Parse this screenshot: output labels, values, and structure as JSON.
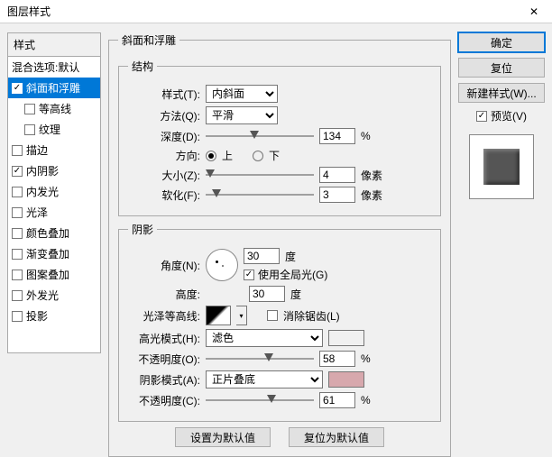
{
  "window": {
    "title": "图层样式"
  },
  "sidebar": {
    "header": "样式",
    "items": [
      {
        "label": "混合选项:默认",
        "checkbox": false,
        "checked": false,
        "selected": false,
        "indent": false
      },
      {
        "label": "斜面和浮雕",
        "checkbox": true,
        "checked": true,
        "selected": true,
        "indent": false
      },
      {
        "label": "等高线",
        "checkbox": true,
        "checked": false,
        "selected": false,
        "indent": true
      },
      {
        "label": "纹理",
        "checkbox": true,
        "checked": false,
        "selected": false,
        "indent": true
      },
      {
        "label": "描边",
        "checkbox": true,
        "checked": false,
        "selected": false,
        "indent": false
      },
      {
        "label": "内阴影",
        "checkbox": true,
        "checked": true,
        "selected": false,
        "indent": false
      },
      {
        "label": "内发光",
        "checkbox": true,
        "checked": false,
        "selected": false,
        "indent": false
      },
      {
        "label": "光泽",
        "checkbox": true,
        "checked": false,
        "selected": false,
        "indent": false
      },
      {
        "label": "颜色叠加",
        "checkbox": true,
        "checked": false,
        "selected": false,
        "indent": false
      },
      {
        "label": "渐变叠加",
        "checkbox": true,
        "checked": false,
        "selected": false,
        "indent": false
      },
      {
        "label": "图案叠加",
        "checkbox": true,
        "checked": false,
        "selected": false,
        "indent": false
      },
      {
        "label": "外发光",
        "checkbox": true,
        "checked": false,
        "selected": false,
        "indent": false
      },
      {
        "label": "投影",
        "checkbox": true,
        "checked": false,
        "selected": false,
        "indent": false
      }
    ]
  },
  "panel": {
    "title": "斜面和浮雕",
    "structure": {
      "legend": "结构",
      "style_label": "样式(T):",
      "style_value": "内斜面",
      "tech_label": "方法(Q):",
      "tech_value": "平滑",
      "depth_label": "深度(D):",
      "depth_value": "134",
      "depth_unit": "%",
      "depth_pct": 45,
      "direction_label": "方向:",
      "up_label": "上",
      "down_label": "下",
      "direction": "up",
      "size_label": "大小(Z):",
      "size_value": "4",
      "size_unit": "像素",
      "size_pct": 4,
      "soften_label": "软化(F):",
      "soften_value": "3",
      "soften_unit": "像素",
      "soften_pct": 10
    },
    "shading": {
      "legend": "阴影",
      "angle_label": "角度(N):",
      "angle_value": "30",
      "angle_unit": "度",
      "global_light_label": "使用全局光(G)",
      "global_light": true,
      "altitude_label": "高度:",
      "altitude_value": "30",
      "altitude_unit": "度",
      "gloss_label": "光泽等高线:",
      "antialias_label": "消除锯齿(L)",
      "antialias": false,
      "highlight_mode_label": "高光模式(H):",
      "highlight_mode_value": "滤色",
      "highlight_color": "#ffffff",
      "highlight_opacity_label": "不透明度(O):",
      "highlight_opacity_value": "58",
      "highlight_opacity_unit": "%",
      "highlight_opacity_pct": 58,
      "shadow_mode_label": "阴影模式(A):",
      "shadow_mode_value": "正片叠底",
      "shadow_color": "#d7a8ad",
      "shadow_opacity_label": "不透明度(C):",
      "shadow_opacity_value": "61",
      "shadow_opacity_unit": "%",
      "shadow_opacity_pct": 61
    },
    "buttons": {
      "default": "设置为默认值",
      "reset": "复位为默认值"
    }
  },
  "right": {
    "ok": "确定",
    "cancel": "复位",
    "new_style": "新建样式(W)...",
    "preview_label": "预览(V)",
    "preview_checked": true
  }
}
